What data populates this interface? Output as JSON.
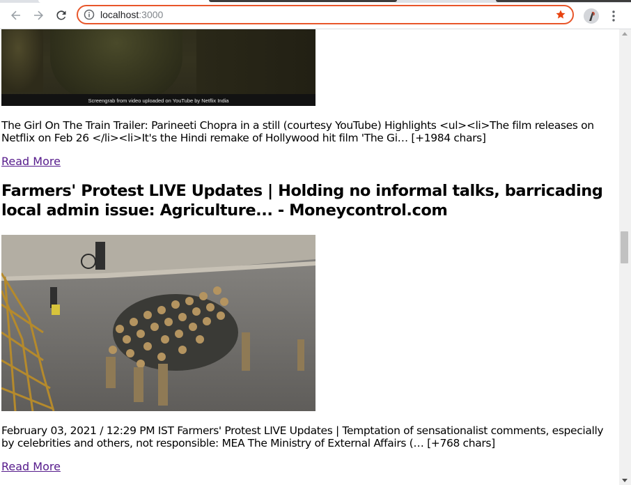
{
  "browser": {
    "url_host": "localhost",
    "url_port": ":3000",
    "accent_color": "#e8562a"
  },
  "articles": [
    {
      "image_caption": "Screengrab from video uploaded on YouTube by Netflix India",
      "description": "The Girl On The Train Trailer: Parineeti Chopra in a still (courtesy YouTube) Highlights <ul><li>The film releases on Netflix on Feb 26 </li><li>It's the Hindi remake of Hollywood hit film 'The Gi… [+1984 chars]",
      "read_more": "Read More"
    },
    {
      "title": "Farmers' Protest LIVE Updates | Holding no informal talks, barricading local admin issue: Agriculture... - Moneycontrol.com",
      "description": "February 03, 2021 / 12:29 PM IST Farmers' Protest LIVE Updates | Temptation of sensationalist comments, especially by celebrities and others, not responsible: MEA The Ministry of External Affairs (… [+768 chars]",
      "read_more": "Read More"
    }
  ],
  "icons": {
    "back": "arrow-left-icon",
    "forward": "arrow-right-icon",
    "reload": "reload-icon",
    "site_info": "info-icon",
    "bookmark": "star-icon",
    "profile": "avatar-icon",
    "menu": "kebab-menu-icon"
  }
}
